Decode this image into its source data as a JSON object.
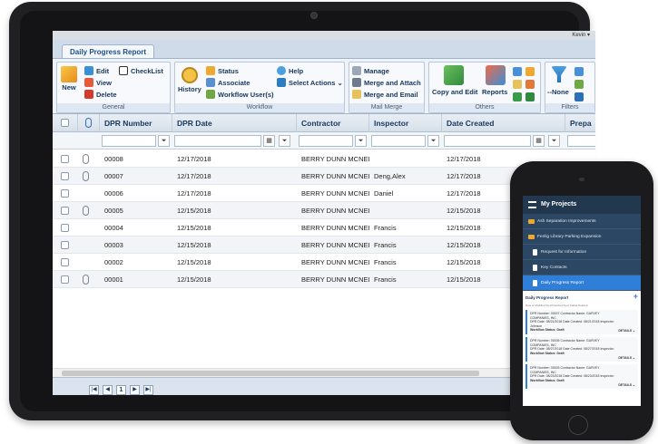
{
  "app": {
    "user_label": "Kevin ▾",
    "tab": "Daily Progress Report"
  },
  "ribbon": {
    "general": {
      "label": "General",
      "new": "New",
      "edit": "Edit",
      "checklist": "CheckList",
      "view": "View",
      "delete": "Delete"
    },
    "workflow": {
      "label": "Workflow",
      "history": "History",
      "status": "Status",
      "associate": "Associate",
      "workflow_users": "Workflow User(s)",
      "help": "Help",
      "select_actions": "Select Actions ⌄"
    },
    "mail_merge": {
      "label": "Mail Merge",
      "manage": "Manage",
      "merge_attach": "Merge and Attach",
      "merge_email": "Merge and Email"
    },
    "others": {
      "label": "Others",
      "copy_edit": "Copy and Edit",
      "reports": "Reports"
    },
    "filters": {
      "label": "Filters",
      "none": "--None"
    }
  },
  "grid": {
    "columns": [
      "DPR Number",
      "DPR Date",
      "Contractor",
      "Inspector",
      "Date Created",
      "Prepa"
    ],
    "rows": [
      {
        "number": "00008",
        "date": "12/17/2018",
        "contractor": "BERRY DUNN MCNEI",
        "inspector": "",
        "created": "12/17/2018",
        "attach": true
      },
      {
        "number": "00007",
        "date": "12/17/2018",
        "contractor": "BERRY DUNN MCNEI",
        "inspector": "Deng,Alex",
        "created": "12/17/2018",
        "attach": true
      },
      {
        "number": "00006",
        "date": "12/17/2018",
        "contractor": "BERRY DUNN MCNEI",
        "inspector": "Daniel",
        "created": "12/17/2018",
        "attach": false
      },
      {
        "number": "00005",
        "date": "12/15/2018",
        "contractor": "BERRY DUNN MCNEI",
        "inspector": "",
        "created": "12/15/2018",
        "attach": true
      },
      {
        "number": "00004",
        "date": "12/15/2018",
        "contractor": "BERRY DUNN MCNEI",
        "inspector": "Francis",
        "created": "12/15/2018",
        "attach": false
      },
      {
        "number": "00003",
        "date": "12/15/2018",
        "contractor": "BERRY DUNN MCNEI",
        "inspector": "Francis",
        "created": "12/15/2018",
        "attach": false
      },
      {
        "number": "00002",
        "date": "12/15/2018",
        "contractor": "BERRY DUNN MCNEI",
        "inspector": "Francis",
        "created": "12/15/2018",
        "attach": false
      },
      {
        "number": "00001",
        "date": "12/15/2018",
        "contractor": "BERRY DUNN MCNEI",
        "inspector": "Francis",
        "created": "12/15/2018",
        "attach": true
      }
    ]
  },
  "pager": {
    "first": "|◀",
    "prev": "◀",
    "page": "1",
    "next": "▶",
    "last": "▶|"
  },
  "phone": {
    "title": "My Projects",
    "nav": [
      {
        "label": "Ash Separation Improvements",
        "type": "folder"
      },
      {
        "label": "Fenlig Library Parking Expansion",
        "type": "folder"
      },
      {
        "label": "Request for Information",
        "type": "doc"
      },
      {
        "label": "Key Contacts",
        "type": "doc"
      },
      {
        "label": "Daily Progress Report",
        "type": "doc",
        "active": true
      }
    ],
    "list_title": "Daily Progress Report",
    "legend": "New or Modified  Synchronized  Sync Failed  Deleted",
    "cards": [
      {
        "line1": "DPR Number: 00007 Contractor Name: GARVEY",
        "line2": "COMPANIES, INC",
        "line3": "DPR Date: 08/21/2018 Date Created: 08/21/2018 Inspector:",
        "line4": "Johnson",
        "status": "Workflow Status: Draft",
        "details": "DETAILS ⌄"
      },
      {
        "line1": "DPR Number: 00005 Contractor Name: GARVEY",
        "line2": "COMPANIES, INC",
        "line3": "DPR Date: 08/27/2018 Date Created: 08/27/2018 Inspector:",
        "line4": "",
        "status": "Workflow Status: Draft",
        "details": "DETAILS ⌄"
      },
      {
        "line1": "DPR Number: 00003 Contractor Name: GARVEY",
        "line2": "COMPANIES, INC",
        "line3": "DPR Date: 08/23/2018 Date Created: 08/23/2018 Inspector:",
        "line4": "",
        "status": "Workflow Status: Draft",
        "details": "DETAILS ⌄"
      }
    ]
  },
  "colors": {
    "tablet": "#202022",
    "ribbon": "#eef3f9",
    "accent": "#2f7ed8",
    "phone_nav": "#2c4763"
  }
}
